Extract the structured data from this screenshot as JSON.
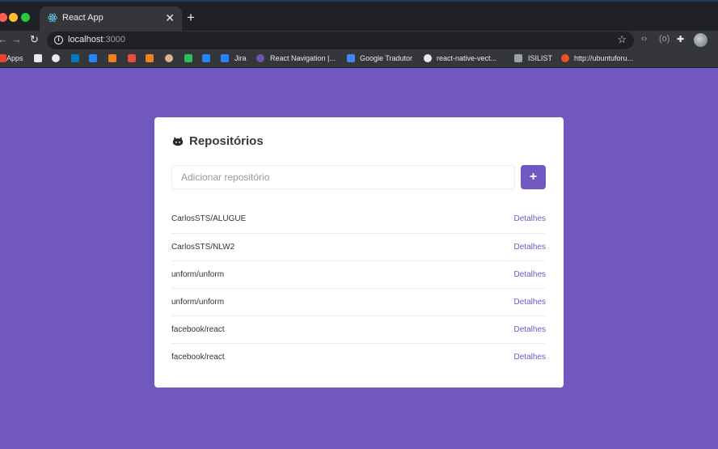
{
  "browser": {
    "tab_title": "React App",
    "tab_close": "✕",
    "new_tab": "+",
    "url_host": "localhost",
    "url_port": ":3000",
    "bookmarks": [
      {
        "label": "Apps",
        "icon": "apps-grid-icon",
        "color": "#ea4335"
      },
      {
        "label": "",
        "icon": "star-bookmark-icon",
        "color": "#e8eaed"
      },
      {
        "label": "",
        "icon": "smiley-icon",
        "color": "#e8eaed"
      },
      {
        "label": "",
        "icon": "trello-icon",
        "color": "#0079bf"
      },
      {
        "label": "",
        "icon": "jira-x-icon",
        "color": "#2684ff"
      },
      {
        "label": "",
        "icon": "stack-icon",
        "color": "#f48024"
      },
      {
        "label": "",
        "icon": "m-icon",
        "color": "#e84c3d"
      },
      {
        "label": "",
        "icon": "hex-icon",
        "color": "#f38020"
      },
      {
        "label": "",
        "icon": "avatar-icon",
        "color": "#d9b38c"
      },
      {
        "label": "",
        "icon": "evernote-icon",
        "color": "#2dbe60"
      },
      {
        "label": "",
        "icon": "x-icon",
        "color": "#2684ff"
      },
      {
        "label": "Jira",
        "icon": "check-icon",
        "color": "#2684ff"
      },
      {
        "label": "React Navigation |...",
        "icon": "react-nav-icon",
        "color": "#6b52ae"
      },
      {
        "label": "Google Tradutor",
        "icon": "translate-icon",
        "color": "#4285f4"
      },
      {
        "label": "react-native-vect...",
        "icon": "github-icon",
        "color": "#e8eaed"
      },
      {
        "label": "ISILIST",
        "icon": "folder-icon",
        "color": "#9aa0a6"
      },
      {
        "label": "http://ubuntuforu...",
        "icon": "ubuntu-icon",
        "color": "#e95420"
      }
    ]
  },
  "app": {
    "title": "Repositórios",
    "input_placeholder": "Adicionar repositório",
    "add_button": "+",
    "repositories": [
      {
        "name": "CarlosSTS/ALUGUE",
        "link": "Detalhes"
      },
      {
        "name": "CarlosSTS/NLW2",
        "link": "Detalhes"
      },
      {
        "name": "unform/unform",
        "link": "Detalhes"
      },
      {
        "name": "unform/unform",
        "link": "Detalhes"
      },
      {
        "name": "facebook/react",
        "link": "Detalhes"
      },
      {
        "name": "facebook/react",
        "link": "Detalhes"
      }
    ]
  },
  "colors": {
    "accent": "#7159c1",
    "background": "#7159c1",
    "card": "#ffffff"
  }
}
